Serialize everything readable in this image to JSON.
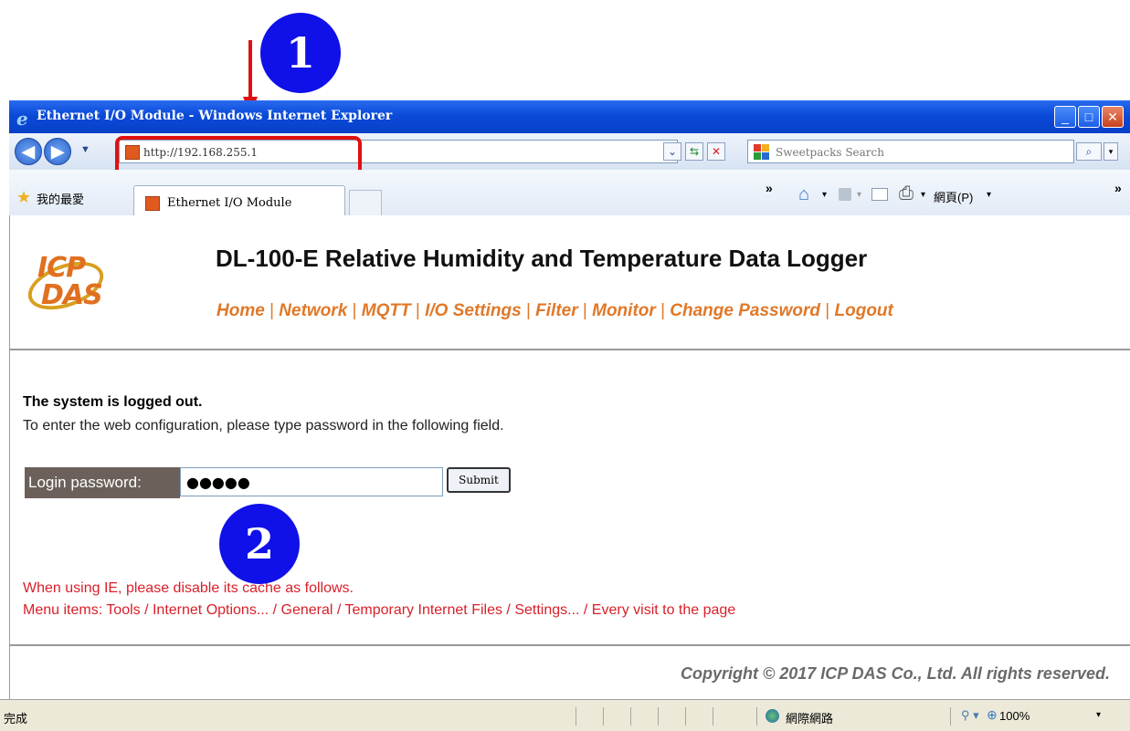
{
  "annotations": {
    "callout_1": "1",
    "callout_2": "2"
  },
  "window": {
    "title": "Ethernet I/O Module - Windows Internet Explorer",
    "minimize": "_",
    "maximize": "□",
    "close": "✕"
  },
  "address_bar": {
    "url": "http://192.168.255.1",
    "search_placeholder": "Sweetpacks Search"
  },
  "favorites_bar": {
    "favorites_label": "我的最愛",
    "tab_label": "Ethernet I/O Module",
    "overflow": "»",
    "page_menu": "網頁(P)"
  },
  "page": {
    "logo_line1": "ICP",
    "logo_line2": "DAS",
    "title": "DL-100-E Relative Humidity and Temperature Data Logger",
    "menu": [
      "Home",
      "Network",
      "MQTT",
      "I/O Settings",
      "Filter",
      "Monitor",
      "Change Password",
      "Logout"
    ],
    "menu_separator": "|",
    "logged_out": "The system is logged out.",
    "instruction": "To enter the web configuration, please type password in the following field.",
    "login_label": "Login password:",
    "password_value": "●●●●●",
    "submit_label": "Submit",
    "warning_line1": "When using IE, please disable its cache as follows.",
    "warning_line2": "Menu items: Tools / Internet Options... / General / Temporary Internet Files / Settings... / Every visit to the page",
    "copyright": "Copyright © 2017 ICP DAS Co., Ltd. All rights reserved."
  },
  "status_bar": {
    "status": "完成",
    "zone": "網際網路",
    "zoom": "100%"
  },
  "colors": {
    "callout_blue": "#1010e8",
    "highlight_red": "#e01010",
    "menu_orange": "#e07828",
    "warning_red": "#d8202a",
    "login_label_bg": "#6b615a"
  }
}
